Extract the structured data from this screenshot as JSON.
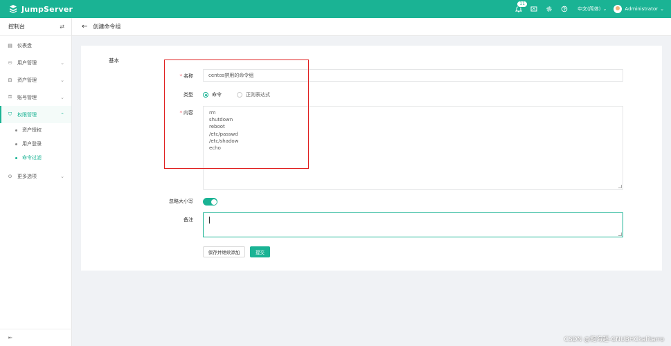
{
  "app": {
    "brand": "JumpServer"
  },
  "topbar": {
    "notifications_count": "11",
    "language": "中文(简体)",
    "user_name": "Administrator"
  },
  "sidebar": {
    "header": "控制台",
    "items": [
      {
        "label": "仪表盘",
        "icon": "dashboard-icon"
      },
      {
        "label": "用户管理",
        "icon": "users-icon"
      },
      {
        "label": "资产管理",
        "icon": "assets-icon"
      },
      {
        "label": "账号管理",
        "icon": "accounts-icon"
      },
      {
        "label": "权限管理",
        "icon": "shield-icon"
      },
      {
        "label": "更多选项",
        "icon": "more-icon"
      }
    ],
    "subitems": [
      {
        "label": "资产授权"
      },
      {
        "label": "用户登录"
      },
      {
        "label": "命令过滤"
      }
    ]
  },
  "page": {
    "title": "创建命令组"
  },
  "form": {
    "section": "基本",
    "name_label": "名称",
    "name_value": "centos禁用的命令组",
    "type_label": "类型",
    "type_options": [
      "命令",
      "正则表达式"
    ],
    "content_label": "内容",
    "content_lines": [
      "rm",
      "shutdown",
      "reboot",
      "/etc/passwd",
      "/etc/shadow",
      "echo"
    ],
    "ignore_case_label": "忽略大小写",
    "note_label": "备注",
    "save_continue_label": "保存并继续添加",
    "submit_label": "提交"
  },
  "watermark": "CSDN @鲍海超-GNUBHCkalitarro",
  "colors": {
    "brand": "#1ab394",
    "highlight": "#e02020"
  }
}
